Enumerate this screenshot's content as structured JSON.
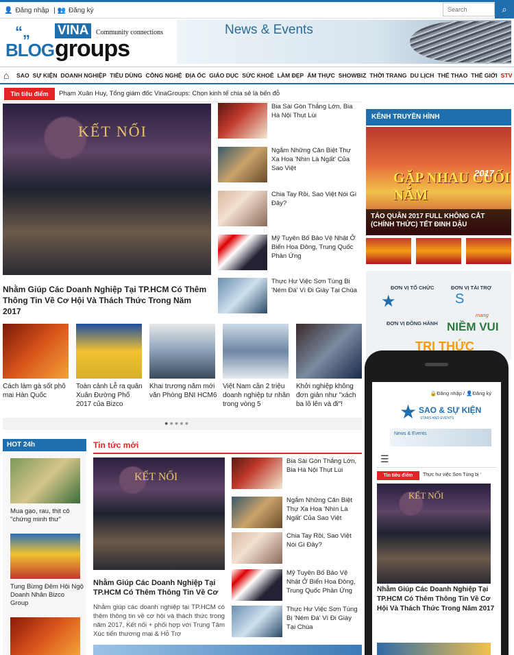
{
  "topbar": {
    "login": "Đăng nhập",
    "register": "Đăng ký",
    "search_placeholder": "Search"
  },
  "logo": {
    "vina": "VINA",
    "blog": "BLOG",
    "groups": "groups",
    "tagline": "Community connections"
  },
  "banner": {
    "text": "News & Events"
  },
  "nav": {
    "items": [
      "SAO",
      "SỰ KIỆN",
      "DOANH NGHIỆP",
      "TIÊU DÙNG",
      "CÔNG NGHỆ",
      "ĐỊA ỐC",
      "GIÁO DỤC",
      "SỨC KHOẺ",
      "LÀM ĐẸP",
      "ẨM THỰC",
      "SHOWBIZ",
      "THỜI TRANG",
      "DU LỊCH",
      "THỂ THAO",
      "THẾ GIỚI",
      "STV"
    ]
  },
  "ticker": {
    "label": "Tin tiêu điểm",
    "text": "Phạm Xuân Huy, Tổng giám đốc VinaGroups: Chọn kinh tế chia sẻ là bến đỗ"
  },
  "feature": {
    "photo_text": "KẾT NỐI",
    "title": "Nhằm Giúp Các Doanh Nghiệp Tại TP.HCM Có Thêm Thông Tin Về Cơ Hội Và Thách Thức Trong Năm 2017"
  },
  "side_list": [
    "Bia Sài Gòn Thắng Lớn, Bia Hà Nội Thụt Lùi",
    "Ngắm Những Căn Biệt Thự Xa Hoa 'Nhìn Là Ngất' Của Sao Việt",
    "Chia Tay Rồi, Sao Việt Nói Gì Đây?",
    "Mỹ Tuyên Bố Bảo Vệ Nhật Ở Biển Hoa Đông, Trung Quốc Phản Ứng",
    "Thực Hư Việc Sơn Tùng Bị 'Ném Đá' Vì Đi Giày Tại Chùa"
  ],
  "tv": {
    "header": "KÊNH TRUYỀN HÌNH",
    "img_text": "GẶP NHAU CUỐI NĂM",
    "year": "2017",
    "caption": "TÁO QUÂN 2017 FULL KHÔNG CẮT (CHÍNH THỨC) TẾT ĐINH DẬU"
  },
  "sponsor": {
    "org": "ĐƠN VỊ TỔ CHỨC",
    "spons": "ĐƠN VỊ TÀI TRỢ",
    "partner": "ĐƠN VỊ ĐỒNG HÀNH",
    "niem": "NIỀM VUI",
    "tri": "TRI THỨC",
    "mang": "mang"
  },
  "carousel": [
    "Cách làm gà sốt phô mai Hàn Quốc",
    "Toàn cảnh Lễ ra quân Xuân Đường Phố 2017 của Bizco",
    "Khai trương năm mới văn Phòng BNI HCM6",
    "Việt Nam cần 2 triệu doanh nghiệp tư nhân trong vòng 5",
    "Khởi nghiệp không đơn giản như \"xách ba lô lên và đi\"!"
  ],
  "hot24": {
    "header": "HOT 24h",
    "items": [
      "Mua gạo, rau, thịt cô \"chứng minh thư\"",
      "Tung Bừng Đêm Hội Ngộ Doanh Nhân Bizco Group"
    ]
  },
  "news": {
    "header": "Tin tức mới",
    "title": "Nhằm Giúp Các Doanh Nghiệp Tại TP.HCM Có Thêm Thông Tin Về Cơ",
    "desc": "Nhằm giúp các doanh nghiệp tại TP.HCM có thêm thông tin về cơ hội và thách thức trong năm 2017, Kết nối + phối hợp với Trung Tâm Xúc tiến thương mại & Hỗ Trợ",
    "items": [
      "Bia Sài Gòn Thắng Lớn, Bia Hà Nội Thụt Lùi",
      "Ngắm Những Căn Biệt Thự Xa Hoa 'Nhìn Là Ngất' Của Sao Việt",
      "Chia Tay Rồi, Sao Việt Nói Gì Đây?",
      "Mỹ Tuyên Bố Bảo Vệ Nhật Ở Biển Hoa Đông, Trung Quốc Phản Ứng",
      "Thực Hư Việc Sơn Tùng Bị 'Ném Đá' Vì Đi Giày Tại Chùa"
    ]
  },
  "phone": {
    "login": "Đăng nhập",
    "register": "Đăng ký",
    "logo": "SAO & SỰ KIỆN",
    "logo_sub": "STARS AND EVENTS",
    "banner": "News & Events",
    "ticker_label": "Tin tiêu điểm",
    "ticker_text": "Thực hư việc Sơn Tùng bị '",
    "title": "Nhằm Giúp Các Doanh Nghiệp Tại TP.HCM Có Thêm Thông Tin Về Cơ Hội Và Thách Thức Trong Năm 2017",
    "photo_text": "KẾT NỐI"
  }
}
